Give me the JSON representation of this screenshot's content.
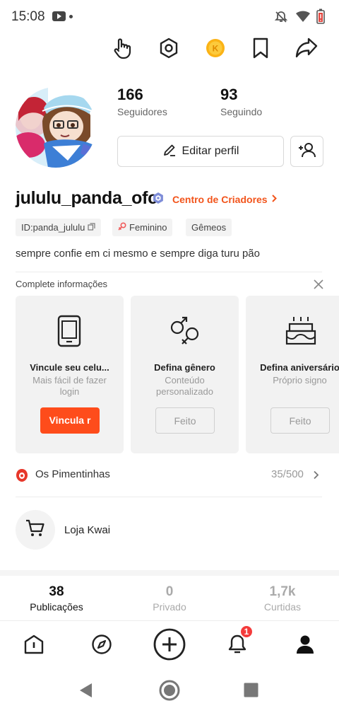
{
  "status_bar": {
    "time": "15:08"
  },
  "profile": {
    "followers_count": "166",
    "followers_label": "Seguidores",
    "following_count": "93",
    "following_label": "Seguindo",
    "edit_button": "Editar perfil",
    "username": "jululu_panda_ofc",
    "creator_center": "Centro de Criadores",
    "tags": {
      "id": "ID:panda_jululu",
      "gender": "Feminino",
      "sign": "Gêmeos"
    },
    "bio": "sempre confie em ci mesmo e sempre diga turu pão"
  },
  "complete_info": {
    "title": "Complete informações",
    "cards": [
      {
        "title": "Vincule seu celu...",
        "subtitle": "Mais fácil de fazer  login",
        "button": "Vincula r",
        "icon": "phone-icon"
      },
      {
        "title": "Defina gênero",
        "subtitle": "Conteúdo personalizado",
        "button": "Feito",
        "icon": "gender-icon"
      },
      {
        "title": "Defina aniversário",
        "subtitle": "Próprio signo",
        "button": "Feito",
        "icon": "cake-icon"
      }
    ]
  },
  "pimentinhas": {
    "label": "Os Pimentinhas",
    "count": "35/500"
  },
  "shop": {
    "label": "Loja Kwai"
  },
  "tabs": [
    {
      "count": "38",
      "label": "Publicações",
      "active": true
    },
    {
      "count": "0",
      "label": "Privado",
      "active": false
    },
    {
      "count": "1,7k",
      "label": "Curtidas",
      "active": false
    }
  ],
  "bottom_nav": {
    "notification_badge": "1"
  },
  "colors": {
    "accent": "#fe4c1b",
    "badge": "#f43b3b"
  }
}
